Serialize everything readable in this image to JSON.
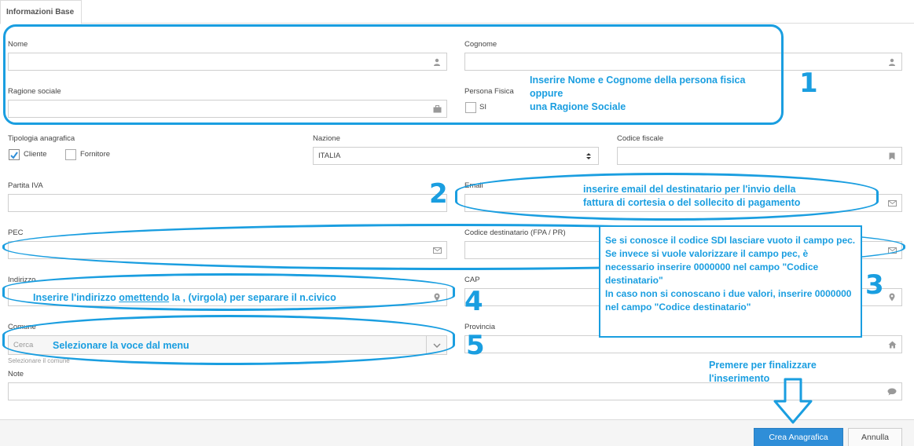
{
  "tab": {
    "label": "Informazioni Base"
  },
  "form": {
    "nome": {
      "label": "Nome",
      "value": ""
    },
    "cognome": {
      "label": "Cognome",
      "value": ""
    },
    "ragione_sociale": {
      "label": "Ragione sociale",
      "value": ""
    },
    "persona_fisica": {
      "label": "Persona Fisica",
      "option": "SI",
      "checked": false
    },
    "tipologia": {
      "label": "Tipologia anagrafica",
      "cliente": "Cliente",
      "cliente_checked": true,
      "fornitore": "Fornitore",
      "fornitore_checked": false
    },
    "nazione": {
      "label": "Nazione",
      "value": "ITALIA"
    },
    "codice_fiscale": {
      "label": "Codice fiscale",
      "value": ""
    },
    "partita_iva": {
      "label": "Partita IVA",
      "value": ""
    },
    "email": {
      "label": "Email",
      "value": ""
    },
    "pec": {
      "label": "PEC",
      "value": ""
    },
    "codice_destinatario": {
      "label": "Codice destinatario (FPA / PR)",
      "value": ""
    },
    "indirizzo": {
      "label": "Indirizzo",
      "value": ""
    },
    "cap": {
      "label": "CAP",
      "value": ""
    },
    "comune": {
      "label": "Comune",
      "placeholder": "Cerca",
      "hint": "Selezionare il comune"
    },
    "provincia": {
      "label": "Provincia",
      "value": ""
    },
    "note": {
      "label": "Note",
      "value": ""
    }
  },
  "annotations": {
    "a1_line1": "Inserire Nome e Cognome della persona fisica",
    "a1_line2": "oppure",
    "a1_line3": "una Ragione Sociale",
    "a2_line1": "inserire email del destinatario per l'invio della",
    "a2_line2": "fattura di cortesia o del sollecito di pagamento",
    "a3_text": "Se si conosce il codice SDI lasciare vuoto il campo pec.\nSe invece si vuole valorizzare il campo pec, è necessario inserire 0000000 nel campo \"Codice destinatario\"\nIn caso non si conoscano i due valori, inserire 0000000 nel campo \"Codice destinatario\"",
    "a4_part1": "Inserire l'indirizzo ",
    "a4_underlined": "omettendo",
    "a4_part2": " la , (virgola) per separare il n.civico",
    "a5": "Selezionare la voce dal menu",
    "a6_line1": "Premere per finalizzare",
    "a6_line2": "l'inserimento",
    "n1": "1",
    "n2": "2",
    "n3": "3",
    "n4": "4",
    "n5": "5"
  },
  "footer": {
    "save_label": "Crea Anagrafica",
    "cancel_label": "Annulla"
  },
  "colors": {
    "annotation": "#1a9ee0",
    "primary_button": "#2f8ed8"
  }
}
